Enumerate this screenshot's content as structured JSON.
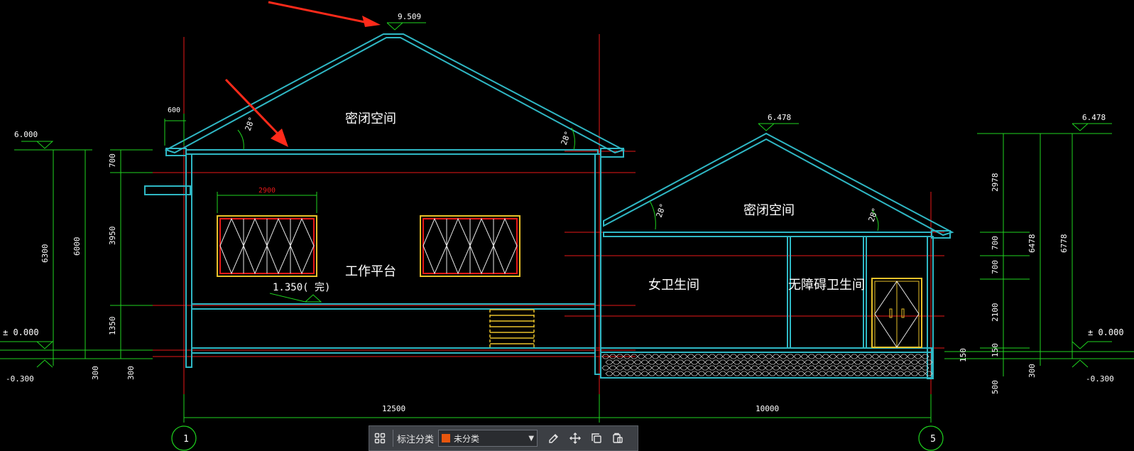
{
  "drawing": {
    "elevations": {
      "ridge_main": "9.509",
      "ridge_annex": "6.478",
      "right_top": "6.478",
      "left_eave": "6.000",
      "left_zero": "± 0.000",
      "right_zero": "± 0.000",
      "left_ground": "-0.300",
      "right_ground": "-0.300",
      "platform": "1.350(  完)"
    },
    "dims": {
      "overhang": "600",
      "window_width": "2900",
      "left_6300": "6300",
      "left_6000": "6000",
      "left_300": "300",
      "inner_700": "700",
      "inner_3950": "3950",
      "inner_1350": "1350",
      "inner_300": "300",
      "bottom_12500": "12500",
      "bottom_10000": "10000",
      "right_2978": "2978",
      "right_700a": "700",
      "right_700b": "700",
      "right_2100": "2100",
      "right_150a": "150",
      "right_150b": "150",
      "right_500": "500",
      "right_6478": "6478",
      "right_6778": "6778",
      "right_300": "300"
    },
    "angles": {
      "main_left": "28°",
      "main_right": "28°",
      "annex_left": "28°",
      "annex_right": "28°"
    },
    "rooms": {
      "attic_main": "密闭空间",
      "attic_annex": "密闭空间",
      "work_platform": "工作平台",
      "women_wc": "女卫生间",
      "accessible_wc": "无障碍卫生间"
    },
    "axes": {
      "left": "1",
      "middle": "",
      "right": "5"
    }
  },
  "toolbar": {
    "label": "标注分类",
    "selected": "未分类",
    "swatch_color": "#e8560e",
    "icons": [
      "grid-icon",
      "edit-icon",
      "move-icon",
      "copy-icon",
      "paste-icon"
    ]
  },
  "colors": {
    "wall": "#2fb7c4",
    "dim": "#1fd41f",
    "axis": "#e81818",
    "window": "#e8c12a",
    "text": "#ffffff",
    "arrow": "#ff2a1a"
  }
}
